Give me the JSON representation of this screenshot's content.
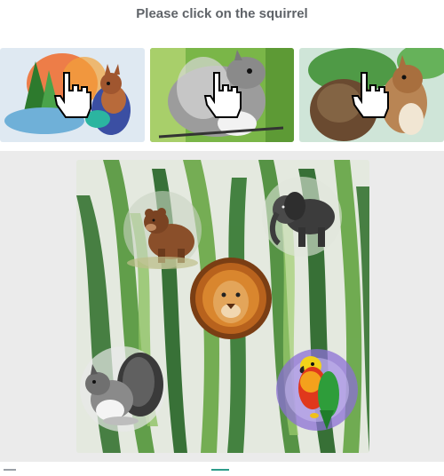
{
  "instruction": "Please click on the squirrel",
  "examples": [
    {
      "name": "squirrel-example-1",
      "icon": "pointing-hand-icon"
    },
    {
      "name": "squirrel-example-2",
      "icon": "pointing-hand-icon"
    },
    {
      "name": "squirrel-example-3",
      "icon": "pointing-hand-icon"
    }
  ],
  "scene": {
    "animals": [
      "bear",
      "elephant",
      "lion",
      "squirrel",
      "parrot"
    ]
  },
  "colors": {
    "panel_bg": "#ebebeb",
    "instruction_text": "#5f6368",
    "leaf_green": "#3f7a3a"
  }
}
